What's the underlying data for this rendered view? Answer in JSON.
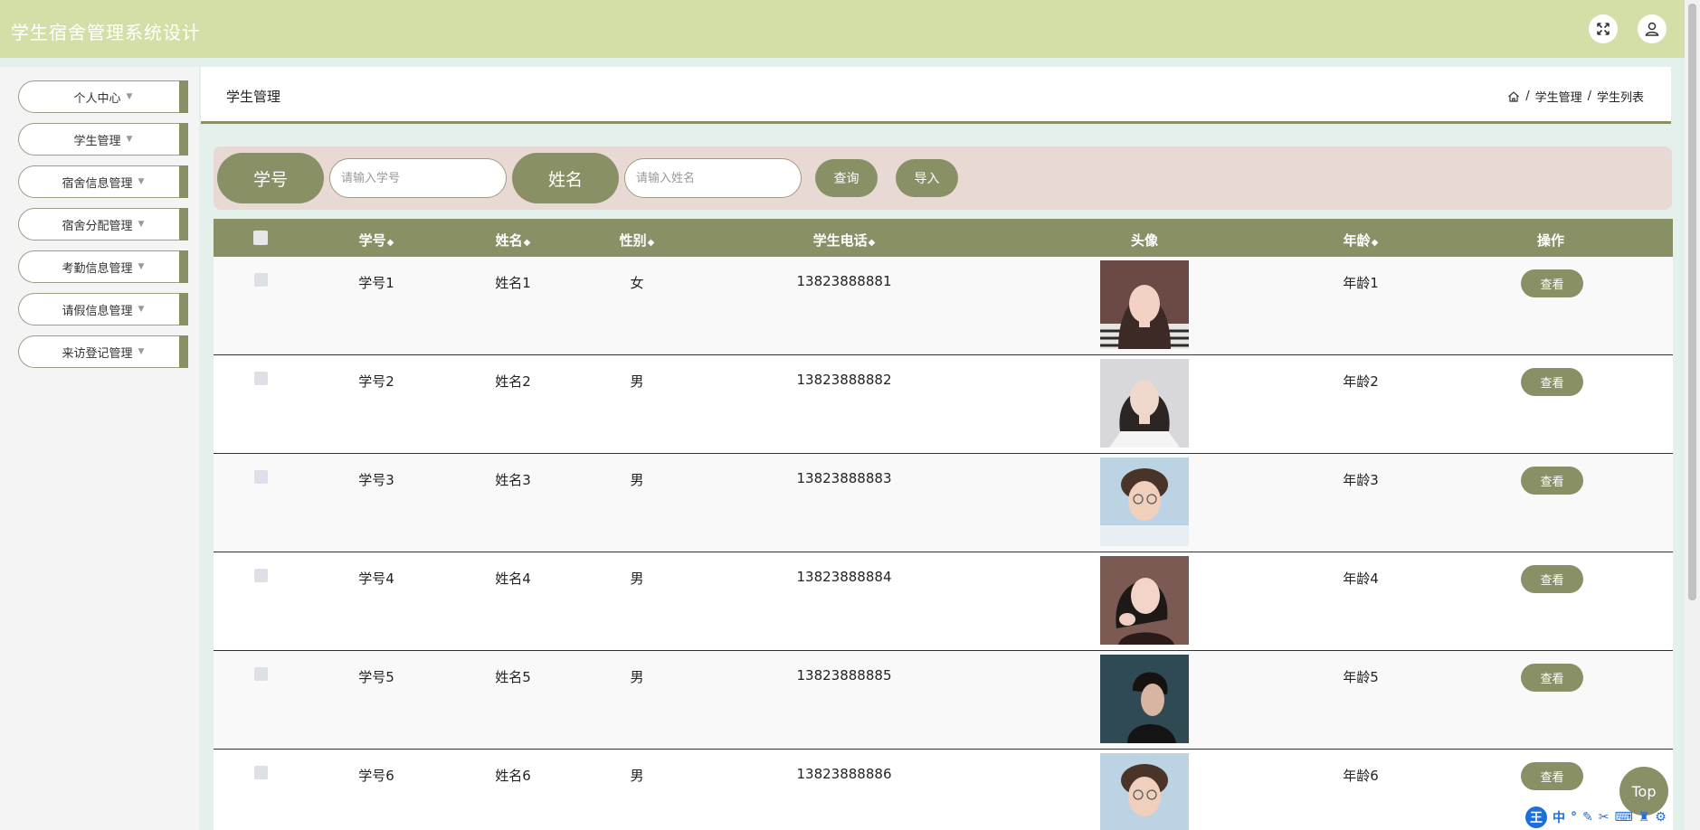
{
  "app": {
    "title": "学生宿舍管理系统设计"
  },
  "header": {
    "fullscreen_icon": "fullscreen-icon",
    "user_icon": "user-icon"
  },
  "sidebar": {
    "items": [
      {
        "label": "个人中心"
      },
      {
        "label": "学生管理"
      },
      {
        "label": "宿舍信息管理"
      },
      {
        "label": "宿舍分配管理"
      },
      {
        "label": "考勤信息管理"
      },
      {
        "label": "请假信息管理"
      },
      {
        "label": "来访登记管理"
      }
    ]
  },
  "page": {
    "title": "学生管理",
    "breadcrumb": [
      "学生管理",
      "学生列表"
    ],
    "separator": "/"
  },
  "search": {
    "id_label": "学号",
    "id_placeholder": "请输入学号",
    "name_label": "姓名",
    "name_placeholder": "请输入姓名",
    "query_label": "查询",
    "import_label": "导入"
  },
  "table": {
    "columns": {
      "id": "学号",
      "name": "姓名",
      "gender": "性别",
      "phone": "学生电话",
      "avatar": "头像",
      "age": "年龄",
      "action": "操作"
    },
    "sort_glyph": "◆",
    "view_label": "查看",
    "rows": [
      {
        "id": "学号1",
        "name": "姓名1",
        "gender": "女",
        "phone": "13823888881",
        "age": "年龄1"
      },
      {
        "id": "学号2",
        "name": "姓名2",
        "gender": "男",
        "phone": "13823888882",
        "age": "年龄2"
      },
      {
        "id": "学号3",
        "name": "姓名3",
        "gender": "男",
        "phone": "13823888883",
        "age": "年龄3"
      },
      {
        "id": "学号4",
        "name": "姓名4",
        "gender": "男",
        "phone": "13823888884",
        "age": "年龄4"
      },
      {
        "id": "学号5",
        "name": "姓名5",
        "gender": "男",
        "phone": "13823888885",
        "age": "年龄5"
      },
      {
        "id": "学号6",
        "name": "姓名6",
        "gender": "男",
        "phone": "13823888886",
        "age": "年龄6"
      }
    ]
  },
  "top_button": {
    "label": "Top"
  },
  "ime": {
    "logo": "王",
    "lang": "中"
  },
  "colors": {
    "accent": "#8a9066",
    "header_bg": "#d4dfa8",
    "search_bg": "#e8d9d4"
  }
}
